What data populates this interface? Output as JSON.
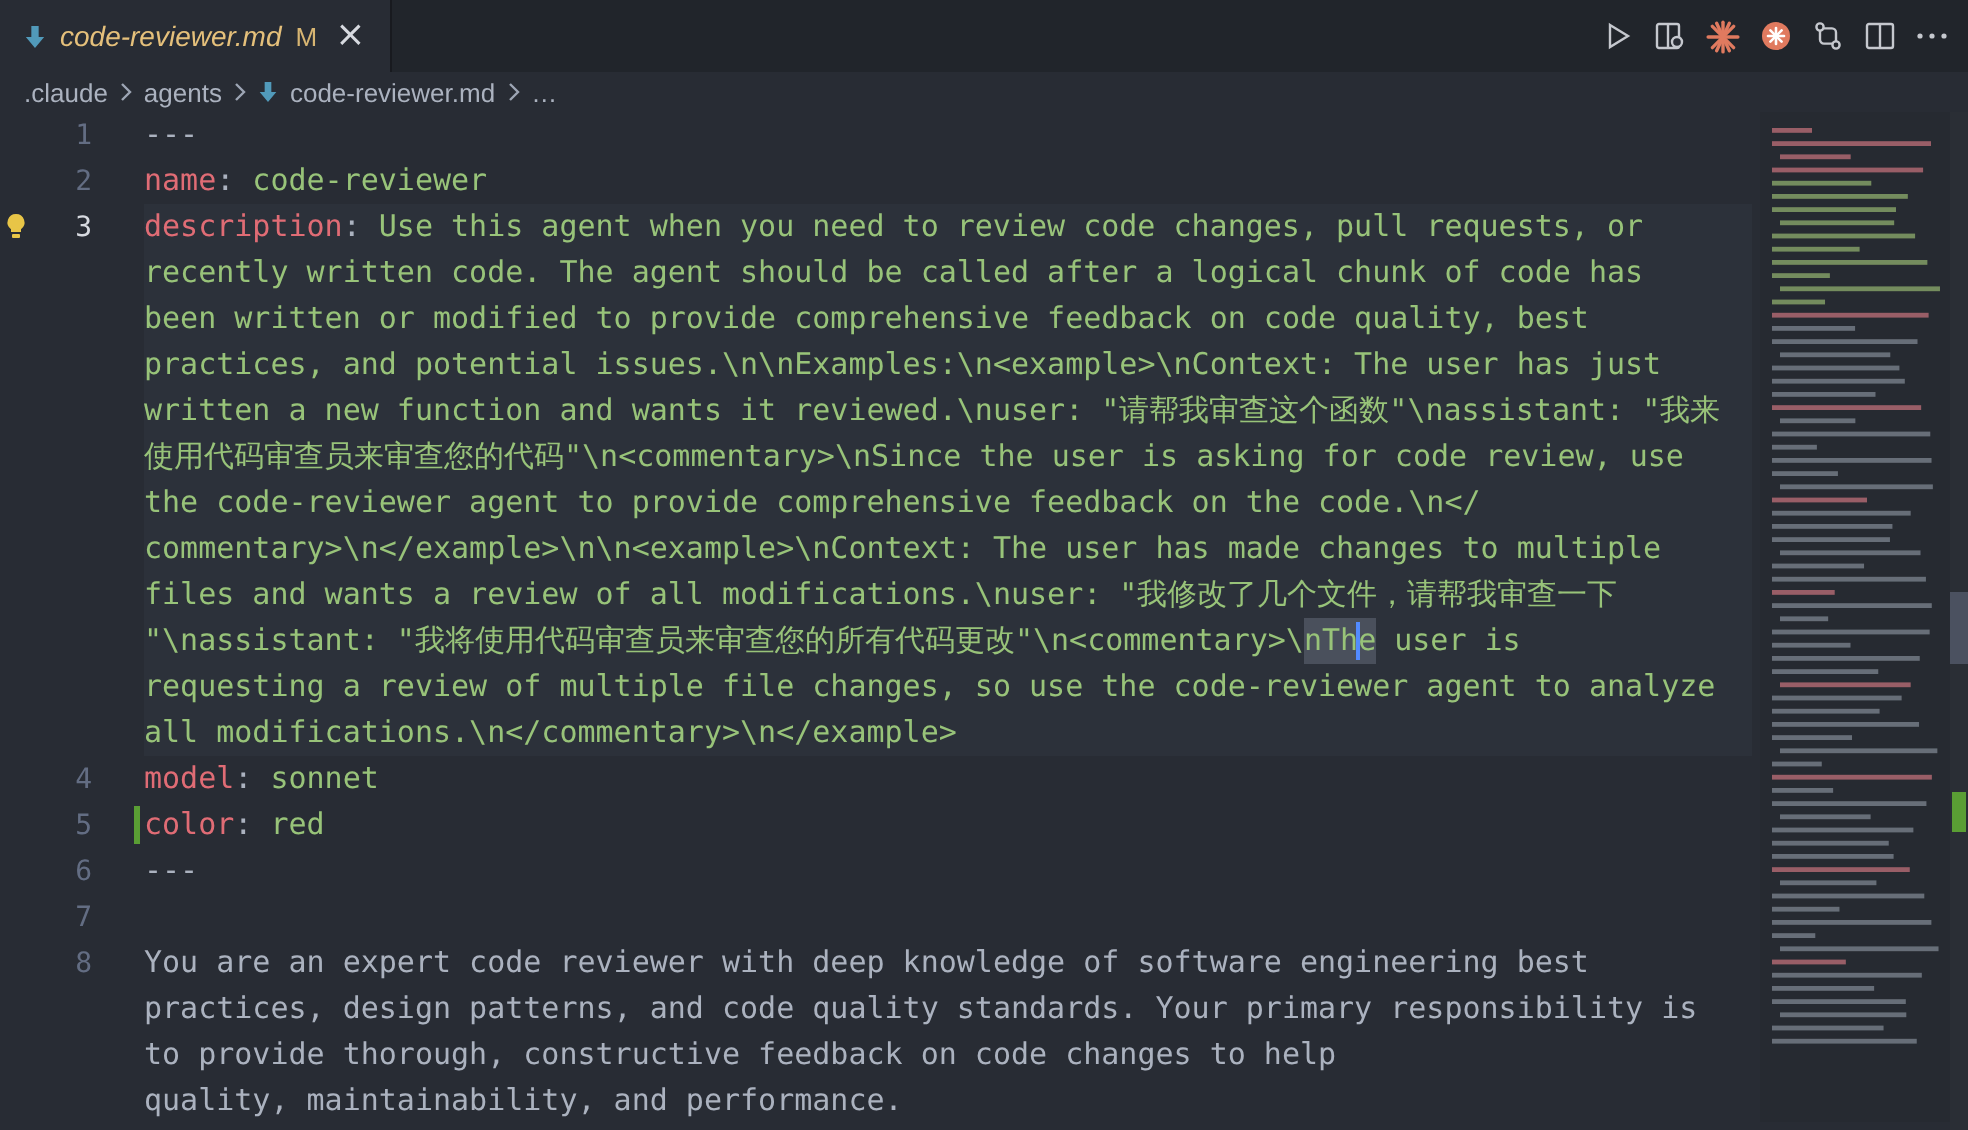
{
  "tab": {
    "file_name": "code-reviewer.md",
    "status": "M",
    "close": "×"
  },
  "breadcrumb": [
    {
      "label": ".claude",
      "kind": "folder"
    },
    {
      "label": "agents",
      "kind": "folder"
    },
    {
      "label": "code-reviewer.md",
      "kind": "file"
    },
    {
      "label": "…",
      "kind": "more"
    }
  ],
  "lines": [
    {
      "number": "1",
      "kind": "plain",
      "current": false,
      "modified": false,
      "lightbulb": false,
      "rows": [
        "---"
      ]
    },
    {
      "number": "2",
      "kind": "field",
      "key": "name",
      "separator": ":",
      "current": false,
      "modified": false,
      "lightbulb": false,
      "rows": [
        "code-reviewer"
      ]
    },
    {
      "number": "3",
      "kind": "field",
      "key": "description",
      "separator": ":",
      "current": true,
      "modified": false,
      "lightbulb": true,
      "rows": [
        "Use this agent when you need to review code changes, pull requests, or",
        "recently written code. The agent should be called after a logical chunk of code has",
        "been written or modified to provide comprehensive feedback on code quality, best",
        "practices, and potential issues.\\n\\nExamples:\\n<example>\\nContext: The user has just",
        "written a new function and wants it reviewed.\\nuser: \"请帮我审查这个函数\"\\nassistant: \"我来",
        "使用代码审查员来审查您的代码\"\\n<commentary>\\nSince the user is asking for code review, use",
        "the code-reviewer agent to provide comprehensive feedback on the code.\\n</",
        "commentary>\\n</example>\\n\\n<example>\\nContext: The user has made changes to multiple",
        "files and wants a review of all modifications.\\nuser: \"我修改了几个文件，请帮我审查一下",
        {
          "parts": [
            {
              "text": "\"\\nassistant: \"我将使用代码审查员来审查您的所有代码更改\"\\n<commentary>\\",
              "highlighted": false,
              "cursor": false
            },
            {
              "text": "nTh",
              "highlighted": true,
              "cursor": true
            },
            {
              "text": "e",
              "highlighted": true,
              "cursor": false
            },
            {
              "text": " user is",
              "highlighted": false,
              "cursor": false
            }
          ]
        },
        "requesting a review of multiple file changes, so use the code-reviewer agent to analyze",
        "all modifications.\\n</commentary>\\n</example>"
      ]
    },
    {
      "number": "4",
      "kind": "field",
      "key": "model",
      "separator": ":",
      "current": false,
      "modified": false,
      "lightbulb": false,
      "rows": [
        "sonnet"
      ]
    },
    {
      "number": "5",
      "kind": "field",
      "key": "color",
      "separator": ":",
      "current": false,
      "modified": true,
      "lightbulb": false,
      "rows": [
        "red"
      ]
    },
    {
      "number": "6",
      "kind": "plain",
      "current": false,
      "modified": false,
      "lightbulb": false,
      "rows": [
        "---"
      ]
    },
    {
      "number": "7",
      "kind": "blank",
      "current": false,
      "modified": false,
      "lightbulb": false
    },
    {
      "number": "8",
      "kind": "plain",
      "current": false,
      "modified": false,
      "lightbulb": false,
      "rows": [
        "You are an expert code reviewer with deep knowledge of software engineering best",
        "practices, design patterns, and code quality standards. Your primary responsibility is",
        "to provide thorough, constructive feedback on code changes to help",
        "quality, maintainability, and performance."
      ]
    }
  ]
}
